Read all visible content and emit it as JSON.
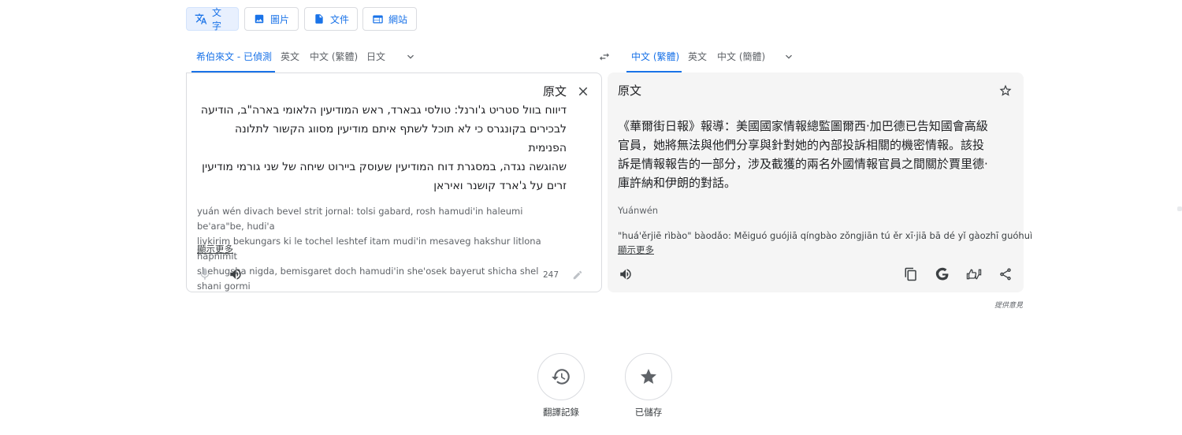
{
  "mode_tabs": [
    {
      "label": "文字",
      "icon": "translate-icon",
      "active": true
    },
    {
      "label": "圖片",
      "icon": "image-icon",
      "active": false
    },
    {
      "label": "文件",
      "icon": "document-icon",
      "active": false
    },
    {
      "label": "網站",
      "icon": "website-icon",
      "active": false
    }
  ],
  "source_langs": [
    "希伯來文 - 已偵測",
    "英文",
    "中文 (繁體)",
    "日文"
  ],
  "target_langs": [
    "中文 (繁體)",
    "英文",
    "中文 (簡體)"
  ],
  "source": {
    "title": "原文",
    "text": "דיווח בוול סטריט ג'ורנל: טולסי גבארד, ראש המודיעין הלאומי בארה\"ב, הודיעה\nלבכירים בקונגרס כי לא תוכל לשתף איתם מודיעין מסווג הקשור לתלונה הפנימית\nשהוגשה נגדה, במסגרת דוח המודיעין שעוסק ביירוט שיחה של שני גורמי מודיעין\nזרים על ג'ארד קושנר ואיראן",
    "transliteration": "yuán wén divach bevel strit jornal: tolsi gabard, rosh hamudi'in haleumi be'ara\"be, hudi'a\nlivkirim bekungars ki le tochel leshtef itam mudi'in mesaveg hakshur litlona hapnimit\nshehugsha nigda, bemisgaret doch hamudi'in she'osek bayerut shicha shel shani gormi",
    "show_more": "顯示更多",
    "char_count": "247"
  },
  "target": {
    "label": "原文",
    "text": "《華爾街日報》報導：美國國家情報總監圖爾西·加巴德已告知國會高級\n官員，她將無法與他們分享與針對她的內部投訴相關的機密情報。該投\n訴是情報報告的一部分，涉及截獲的兩名外國情報官員之間關於賈里德·\n庫許納和伊朗的對話。",
    "romanized": "Yuánwén",
    "transliteration": "\"huá'ěrjiē rìbào\" bàodǎo: Měiguó guójiā qíngbào zǒngjiān tú ěr xī·jiā bā dé yǐ gàozhī guóhuì",
    "show_more": "顯示更多"
  },
  "feedback": "提供意見",
  "history_label": "翻譯記錄",
  "saved_label": "已儲存",
  "accent_color": "#1a73e8"
}
